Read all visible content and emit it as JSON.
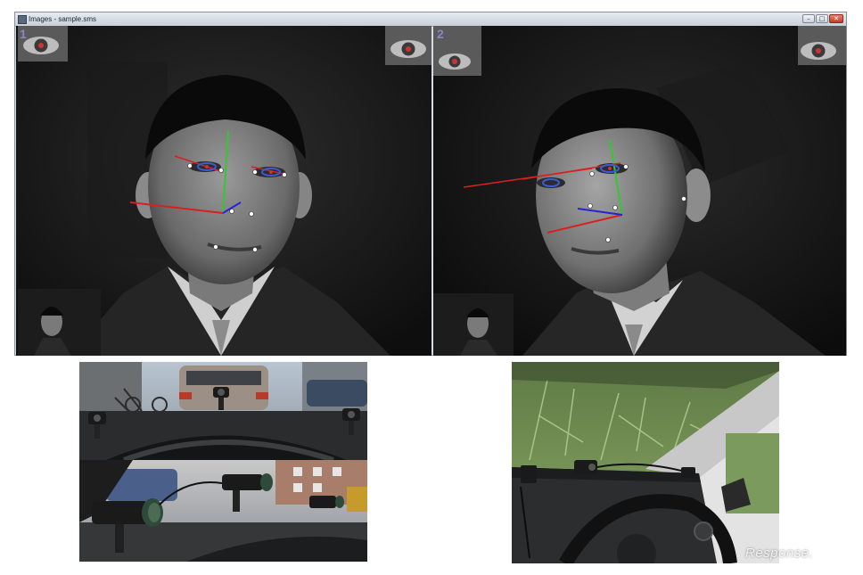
{
  "window": {
    "title": "Images - sample.sms",
    "buttons": {
      "minimize": "–",
      "maximize": "□",
      "close": "✕"
    }
  },
  "panes": [
    {
      "label": "1"
    },
    {
      "label": "2"
    }
  ],
  "watermark": "Response.",
  "colors": {
    "titlebar": "#d6dbe4",
    "axis_red": "#d82020",
    "axis_green": "#32c832",
    "axis_blue": "#2424d6",
    "iris": "#c33"
  }
}
